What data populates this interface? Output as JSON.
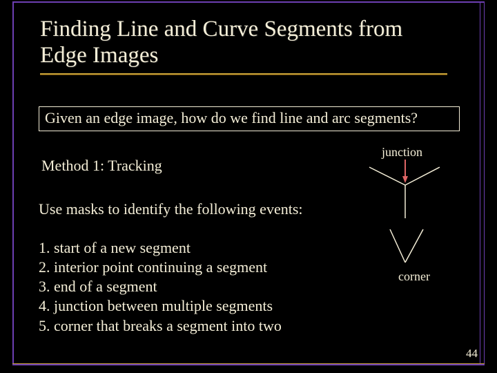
{
  "title": "Finding Line and Curve Segments from Edge Images",
  "question": "Given an edge image, how do we find line and arc segments?",
  "method": "Method 1: Tracking",
  "use_masks": "Use masks to identify the following events:",
  "items": {
    "i1": "1. start of a new segment",
    "i2": "2. interior point continuing a segment",
    "i3": "3. end of a segment",
    "i4": "4. junction between multiple segments",
    "i5": "5. corner that breaks a segment into two"
  },
  "labels": {
    "junction": "junction",
    "corner": "corner"
  },
  "page_number": "44"
}
